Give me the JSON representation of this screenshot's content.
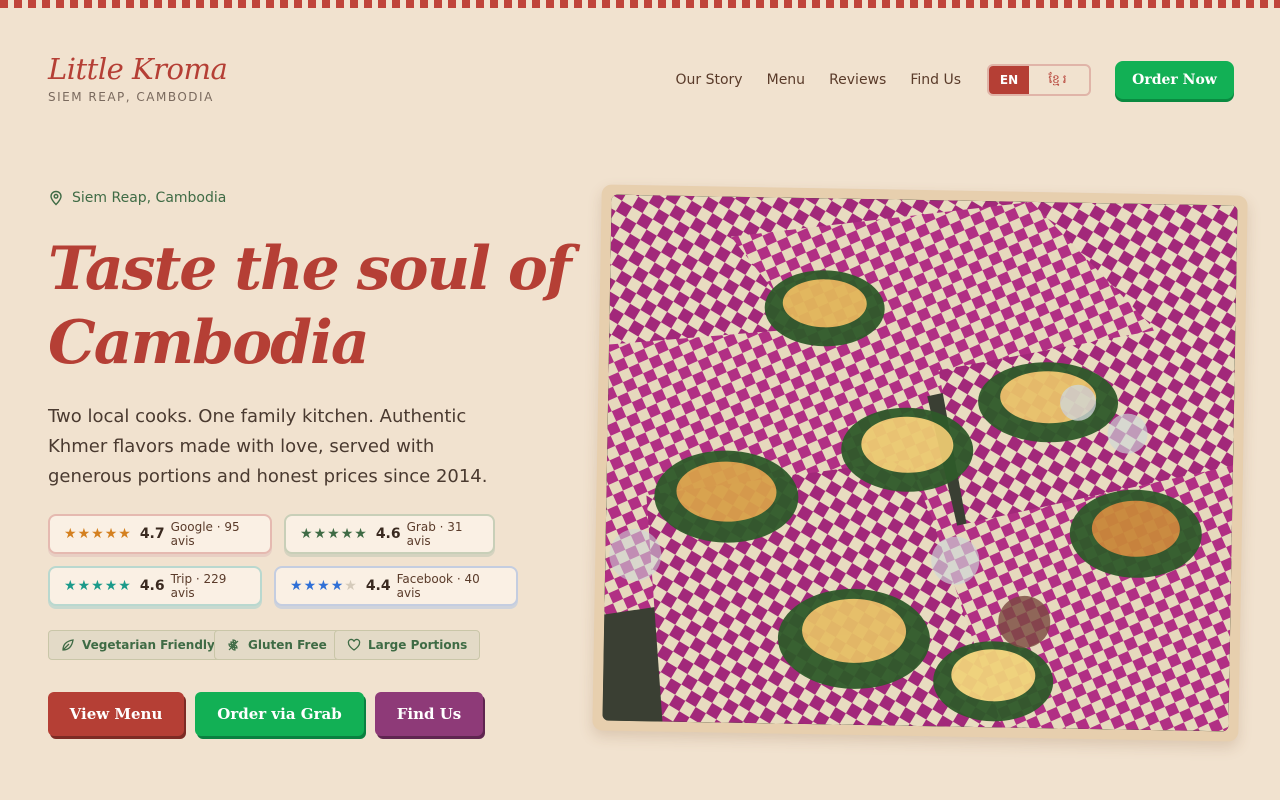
{
  "brand": {
    "name": "Little Kroma",
    "location": "SIEM REAP, CAMBODIA"
  },
  "nav": {
    "items": [
      "Our Story",
      "Menu",
      "Reviews",
      "Find Us"
    ],
    "lang_en": "EN",
    "lang_km": "ខ្មែរ",
    "order_now": "Order Now"
  },
  "hero": {
    "location": "Siem Reap, Cambodia",
    "headline": "Taste the soul of Cambodia",
    "description": "Two local cooks. One family kitchen. Authentic Khmer flavors made with love, served with generous portions and honest prices since 2014."
  },
  "ratings": [
    {
      "score": "4.7",
      "source": "Google · 95 avis",
      "stars": 4.7,
      "color": "#d4801f"
    },
    {
      "score": "4.6",
      "source": "Grab · 31 avis",
      "stars": 4.6,
      "color": "#3f6b45"
    },
    {
      "score": "4.6",
      "source": "Trip · 229 avis",
      "stars": 4.6,
      "color": "#1a9a8a"
    },
    {
      "score": "4.4",
      "source": "Facebook · 40 avis",
      "stars": 4.4,
      "color": "#2f6fd6"
    }
  ],
  "tags": [
    "Vegetarian Friendly",
    "Gluten Free",
    "Large Portions"
  ],
  "buttons": {
    "view_menu": "View Menu",
    "order_grab": "Order via Grab",
    "find_us": "Find Us"
  },
  "colors": {
    "accent": "#b53f35",
    "green": "#12b055",
    "purple": "#8e3a78",
    "background": "#f1e2cf"
  }
}
